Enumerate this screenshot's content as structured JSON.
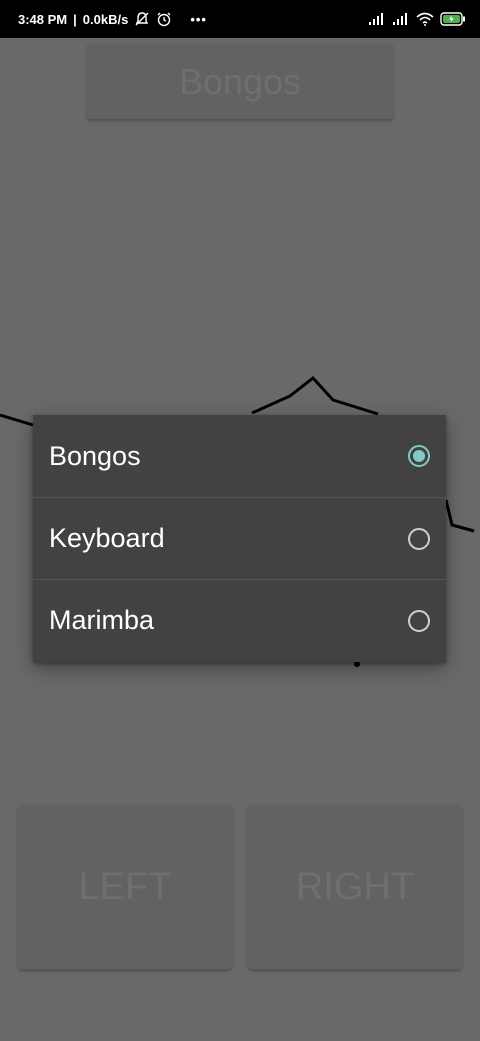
{
  "status_bar": {
    "time": "3:48 PM",
    "network_speed": "0.0kB/s",
    "more": "•••",
    "icons": [
      "notifications-off-icon",
      "alarm-icon",
      "signal-icon",
      "signal-icon",
      "wifi-icon",
      "battery-charging-icon"
    ]
  },
  "app": {
    "instrument_button_label": "Bongos",
    "left_button_label": "LEFT",
    "right_button_label": "RIGHT"
  },
  "dialog": {
    "options": [
      {
        "label": "Bongos",
        "selected": true
      },
      {
        "label": "Keyboard",
        "selected": false
      },
      {
        "label": "Marimba",
        "selected": false
      }
    ]
  },
  "colors": {
    "accent": "#80cbc4",
    "dialog_bg": "#424242",
    "scrim_bg": "#696969"
  }
}
